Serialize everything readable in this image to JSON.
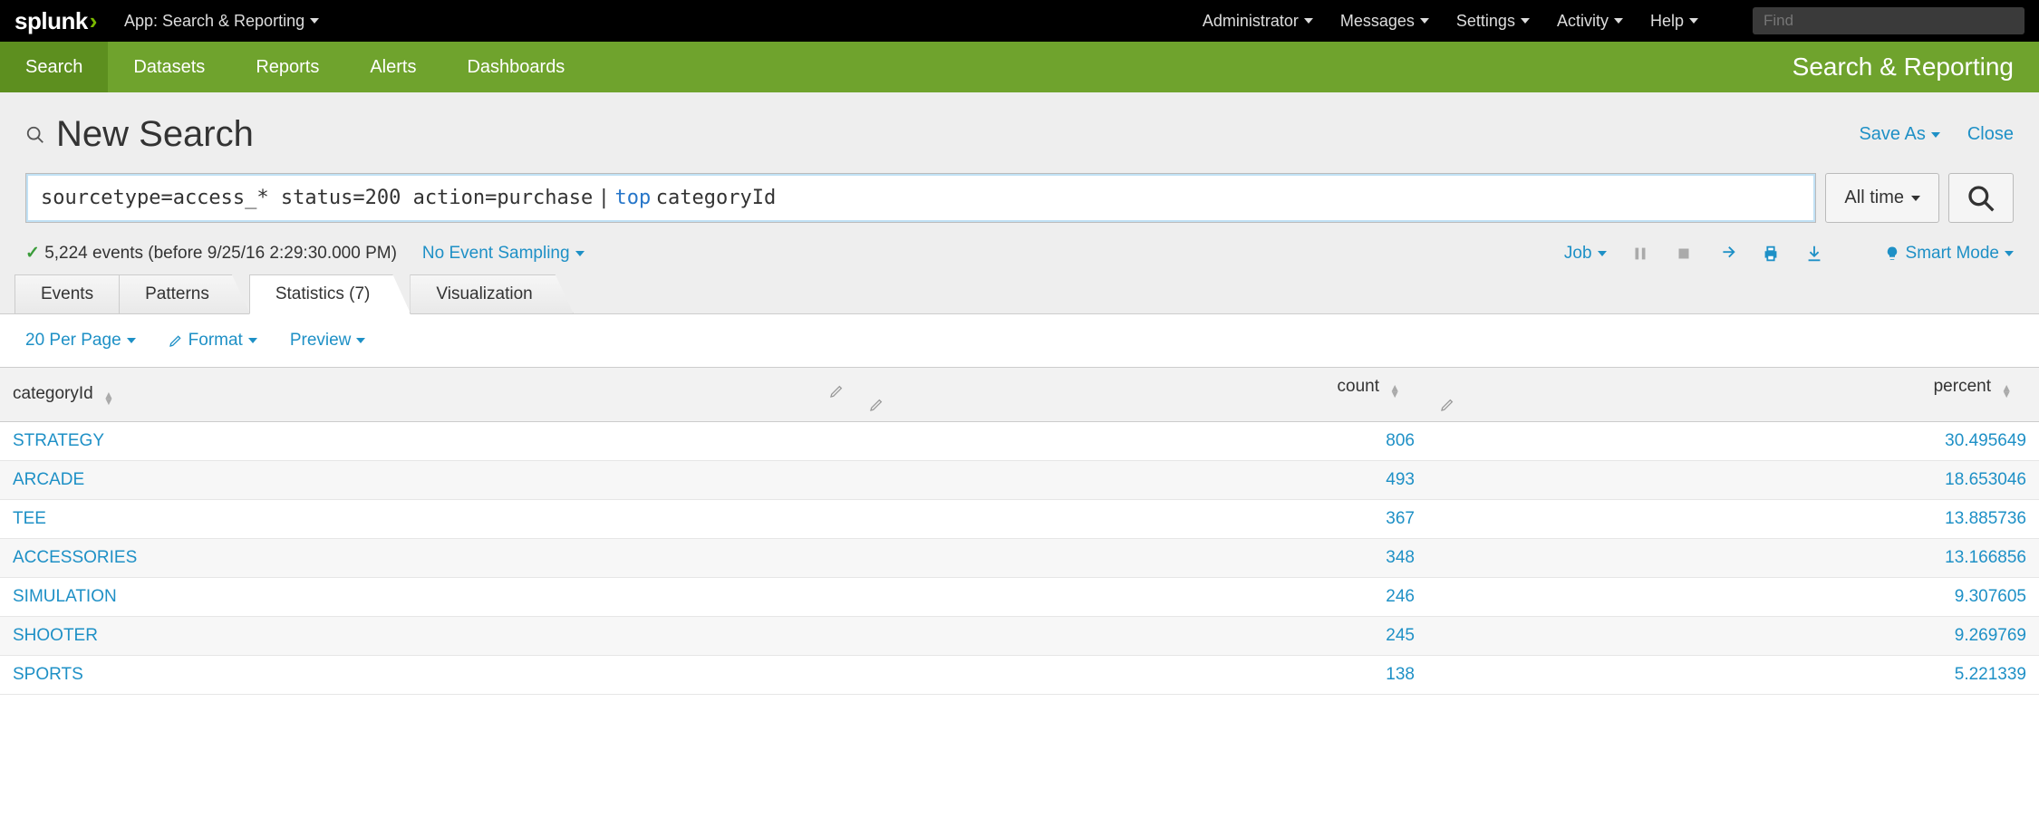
{
  "topbar": {
    "logo_text": "splunk",
    "app_label": "App: Search & Reporting",
    "menu": [
      "Administrator",
      "Messages",
      "Settings",
      "Activity",
      "Help"
    ],
    "find_placeholder": "Find"
  },
  "greenbar": {
    "items": [
      "Search",
      "Datasets",
      "Reports",
      "Alerts",
      "Dashboards"
    ],
    "active_index": 0,
    "title": "Search & Reporting"
  },
  "page": {
    "title": "New Search",
    "save_as": "Save As",
    "close": "Close"
  },
  "search": {
    "query_plain": "sourcetype=access_* status=200 action=purchase",
    "query_pipe": "|",
    "query_cmd": "top",
    "query_arg": "categoryId",
    "time_label": "All time"
  },
  "status": {
    "events_text": "5,224 events (before 9/25/16 2:29:30.000 PM)",
    "sampling": "No Event Sampling",
    "job_label": "Job",
    "mode_label": "Smart Mode"
  },
  "tabs": [
    {
      "label": "Events"
    },
    {
      "label": "Patterns"
    },
    {
      "label": "Statistics (7)"
    },
    {
      "label": "Visualization"
    }
  ],
  "active_tab_index": 2,
  "table_toolbar": {
    "per_page": "20 Per Page",
    "format": "Format",
    "preview": "Preview"
  },
  "table": {
    "columns": [
      "categoryId",
      "count",
      "percent"
    ],
    "rows": [
      {
        "categoryId": "STRATEGY",
        "count": "806",
        "percent": "30.495649"
      },
      {
        "categoryId": "ARCADE",
        "count": "493",
        "percent": "18.653046"
      },
      {
        "categoryId": "TEE",
        "count": "367",
        "percent": "13.885736"
      },
      {
        "categoryId": "ACCESSORIES",
        "count": "348",
        "percent": "13.166856"
      },
      {
        "categoryId": "SIMULATION",
        "count": "246",
        "percent": "9.307605"
      },
      {
        "categoryId": "SHOOTER",
        "count": "245",
        "percent": "9.269769"
      },
      {
        "categoryId": "SPORTS",
        "count": "138",
        "percent": "5.221339"
      }
    ]
  }
}
